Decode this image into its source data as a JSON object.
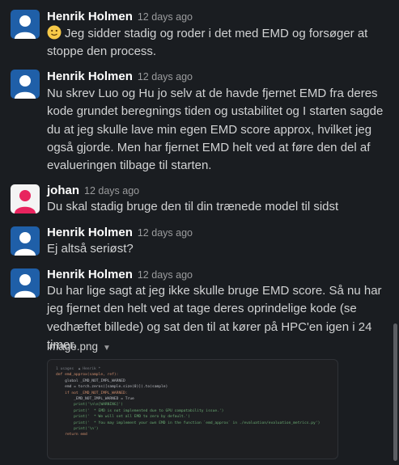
{
  "messages": [
    {
      "author": "Henrik Holmen",
      "time": "12 days ago",
      "emoji": "slightly-smiling-face-icon",
      "text": "Jeg sidder stadig og roder i det med EMD og forsøger at stoppe den process."
    },
    {
      "author": "Henrik Holmen",
      "time": "12 days ago",
      "text": "Nu skrev Luo og Hu jo selv at de havde fjernet EMD fra deres kode grundet beregnings tiden og ustabilitet og I starten sagde du at jeg skulle lave min egen EMD score approx, hvilket jeg også gjorde. Men har fjernet EMD helt ved at føre den del af evalueringen tilbage til starten."
    },
    {
      "author": "johan",
      "time": "12 days ago",
      "text": "Du skal stadig bruge den til din trænede model til sidst"
    },
    {
      "author": "Henrik Holmen",
      "time": "12 days ago",
      "text": "Ej altså seriøst?"
    },
    {
      "author": "Henrik Holmen",
      "time": "12 days ago",
      "text": "Du har lige sagt at jeg ikke skulle bruge EMD score. Så nu har jeg fjernet den helt ved at tage deres oprindelige kode (se vedhæftet billede)  og sat den til at kører på HPC'en igen i 24 timer."
    }
  ],
  "attachment": {
    "filename": "image.png",
    "code_lines": [
      "1 usages  ▲ Henrik *",
      "def emd_approx(sample, ref):",
      "    global _EMD_NOT_IMPL_WARNED",
      "    emd = torch.zeros([sample.size(0)]).to(sample)",
      "    if not _EMD_NOT_IMPL_WARNED:",
      "        _EMD_NOT_IMPL_WARNED = True",
      "        print('\\n\\n[WARNING]')",
      "        print('  * EMD is not implemented due to GPU compatability issue.')",
      "        print('  * We will set all EMD to zero by default.')",
      "        print('  * You may implement your own EMD in the function `emd_approx` in ./evaluation/evaluation_metrics.py')",
      "        print('\\n')",
      "    return emd"
    ]
  },
  "colors": {
    "background": "#1a1d21",
    "henrik_avatar": "#1f5fa8",
    "johan_avatar": "#e8245e"
  }
}
